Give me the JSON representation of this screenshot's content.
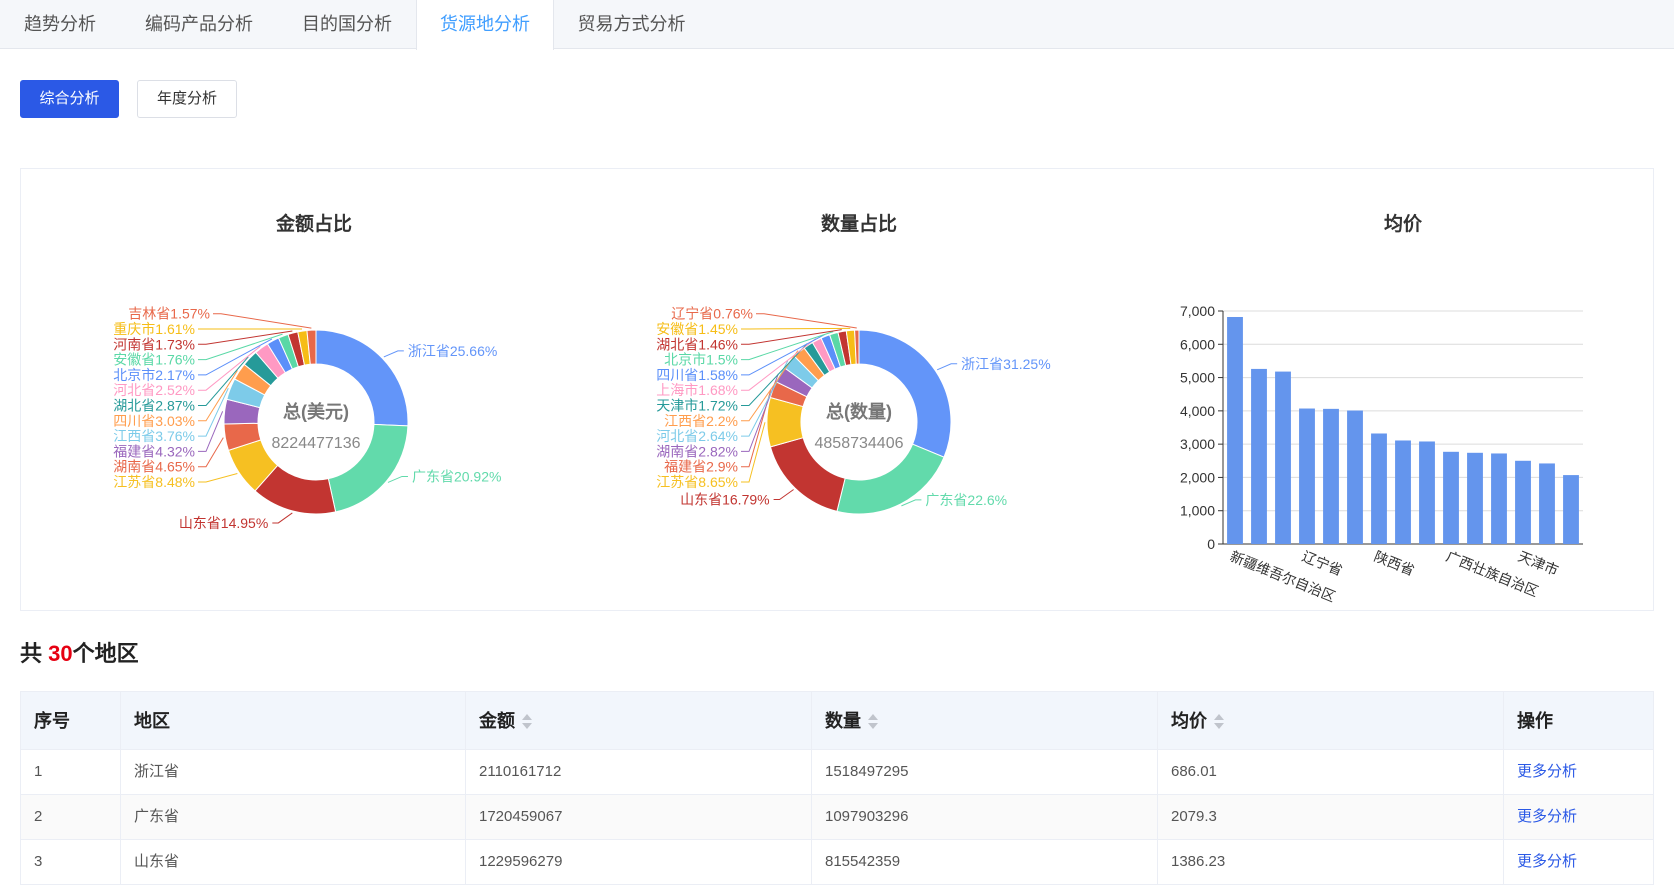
{
  "tabs": [
    {
      "label": "趋势分析",
      "active": false
    },
    {
      "label": "编码产品分析",
      "active": false
    },
    {
      "label": "目的国分析",
      "active": false
    },
    {
      "label": "货源地分析",
      "active": true
    },
    {
      "label": "贸易方式分析",
      "active": false
    }
  ],
  "buttons": {
    "primary": "综合分析",
    "secondary": "年度分析"
  },
  "colors": {
    "accent": "#409eff",
    "primary_btn": "#2b59e6",
    "bar": "#6495ed",
    "highlight": "#e60012"
  },
  "chart_data": [
    {
      "type": "pie",
      "title": "金额占比",
      "center_label": "总(美元)",
      "center_value": "8224477136",
      "slices": [
        {
          "name": "浙江省",
          "value": 25.66,
          "label": "浙江省25.66%",
          "color": "#6395f9"
        },
        {
          "name": "广东省",
          "value": 20.92,
          "label": "广东省20.92%",
          "color": "#62daab"
        },
        {
          "name": "山东省",
          "value": 14.95,
          "label": "山东省14.95%",
          "color": "#c23531"
        },
        {
          "name": "江苏省",
          "value": 8.48,
          "label": "江苏省8.48%",
          "color": "#f6c022"
        },
        {
          "name": "湖南省",
          "value": 4.65,
          "label": "湖南省4.65%",
          "color": "#e8684a"
        },
        {
          "name": "福建省",
          "value": 4.32,
          "label": "福建省4.32%",
          "color": "#9a67bd"
        },
        {
          "name": "江西省",
          "value": 3.76,
          "label": "江西省3.76%",
          "color": "#7dcbe9"
        },
        {
          "name": "四川省",
          "value": 3.03,
          "label": "四川省3.03%",
          "color": "#ff9d4d"
        },
        {
          "name": "湖北省",
          "value": 2.87,
          "label": "湖北省2.87%",
          "color": "#269a99"
        },
        {
          "name": "河北省",
          "value": 2.52,
          "label": "河北省2.52%",
          "color": "#ff99c3"
        },
        {
          "name": "北京市",
          "value": 2.17,
          "label": "北京市2.17%",
          "color": "#5b8ff9"
        },
        {
          "name": "安徽省",
          "value": 1.76,
          "label": "安徽省1.76%",
          "color": "#5ad8a6"
        },
        {
          "name": "河南省",
          "value": 1.73,
          "label": "河南省1.73%",
          "color": "#c23531"
        },
        {
          "name": "重庆市",
          "value": 1.61,
          "label": "重庆市1.61%",
          "color": "#f6bd16"
        },
        {
          "name": "吉林省",
          "value": 1.57,
          "label": "吉林省1.57%",
          "color": "#e8684a"
        }
      ]
    },
    {
      "type": "pie",
      "title": "数量占比",
      "center_label": "总(数量)",
      "center_value": "4858734406",
      "slices": [
        {
          "name": "浙江省",
          "value": 31.25,
          "label": "浙江省31.25%",
          "color": "#6395f9"
        },
        {
          "name": "广东省",
          "value": 22.6,
          "label": "广东省22.6%",
          "color": "#62daab"
        },
        {
          "name": "山东省",
          "value": 16.79,
          "label": "山东省16.79%",
          "color": "#c23531"
        },
        {
          "name": "江苏省",
          "value": 8.65,
          "label": "江苏省8.65%",
          "color": "#f6c022"
        },
        {
          "name": "福建省",
          "value": 2.9,
          "label": "福建省2.9%",
          "color": "#e8684a"
        },
        {
          "name": "湖南省",
          "value": 2.82,
          "label": "湖南省2.82%",
          "color": "#9a67bd"
        },
        {
          "name": "河北省",
          "value": 2.64,
          "label": "河北省2.64%",
          "color": "#7dcbe9"
        },
        {
          "name": "江西省",
          "value": 2.2,
          "label": "江西省2.2%",
          "color": "#ff9d4d"
        },
        {
          "name": "天津市",
          "value": 1.72,
          "label": "天津市1.72%",
          "color": "#269a99"
        },
        {
          "name": "上海市",
          "value": 1.68,
          "label": "上海市1.68%",
          "color": "#ff99c3"
        },
        {
          "name": "四川省",
          "value": 1.58,
          "label": "四川省1.58%",
          "color": "#5b8ff9"
        },
        {
          "name": "北京市",
          "value": 1.5,
          "label": "北京市1.5%",
          "color": "#5ad8a6"
        },
        {
          "name": "湖北省",
          "value": 1.46,
          "label": "湖北省1.46%",
          "color": "#c23531"
        },
        {
          "name": "安徽省",
          "value": 1.45,
          "label": "安徽省1.45%",
          "color": "#f6bd16"
        },
        {
          "name": "辽宁省",
          "value": 0.76,
          "label": "辽宁省0.76%",
          "color": "#e8684a"
        }
      ]
    },
    {
      "type": "bar",
      "title": "均价",
      "ylim": [
        0,
        7000
      ],
      "yticks": [
        "0",
        "1,000",
        "2,000",
        "3,000",
        "4,000",
        "5,000",
        "6,000",
        "7,000"
      ],
      "categories": [
        "新疆维吾尔自治区",
        "",
        "",
        "辽宁省",
        "",
        "",
        "陕西省",
        "",
        "",
        "广西壮族自治区",
        "",
        "",
        "天津市",
        "",
        ""
      ],
      "values": [
        6820,
        5260,
        5180,
        4070,
        4060,
        4010,
        3320,
        3110,
        3080,
        2770,
        2740,
        2720,
        2500,
        2420,
        2070
      ],
      "grid": true
    }
  ],
  "summary": {
    "prefix": "共 ",
    "count": "30",
    "suffix": "个地区"
  },
  "table": {
    "headers": [
      "序号",
      "地区",
      "金额",
      "数量",
      "均价",
      "操作"
    ],
    "rows": [
      {
        "index": "1",
        "region": "浙江省",
        "amount": "2110161712",
        "quantity": "1518497295",
        "avg": "686.01",
        "action": "更多分析"
      },
      {
        "index": "2",
        "region": "广东省",
        "amount": "1720459067",
        "quantity": "1097903296",
        "avg": "2079.3",
        "action": "更多分析"
      },
      {
        "index": "3",
        "region": "山东省",
        "amount": "1229596279",
        "quantity": "815542359",
        "avg": "1386.23",
        "action": "更多分析"
      }
    ]
  }
}
